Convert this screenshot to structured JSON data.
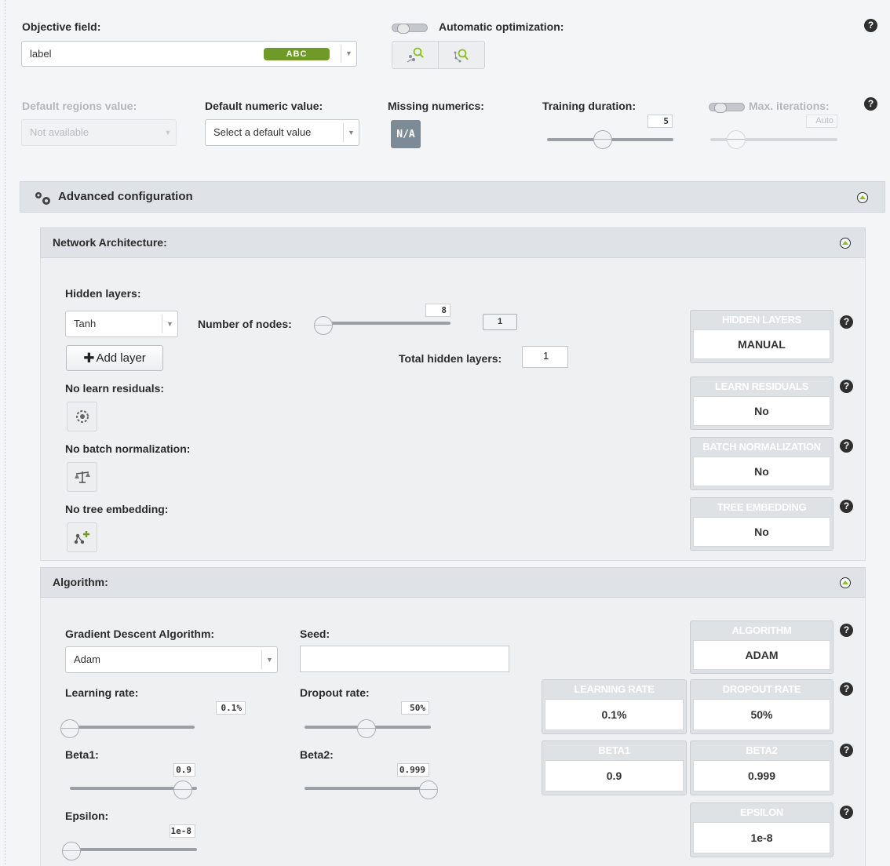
{
  "objective": {
    "label": "Objective field:",
    "value": "label",
    "type_badge": "ABC"
  },
  "auto_opt": {
    "label": "Automatic optimization:",
    "enabled": false
  },
  "top_row": {
    "default_regions": {
      "label": "Default regions value:",
      "value": "Not available"
    },
    "default_numeric": {
      "label": "Default numeric value:",
      "placeholder": "Select a default value"
    },
    "missing_numerics": {
      "label": "Missing numerics:",
      "button": "N/A"
    },
    "training_duration": {
      "label": "Training duration:",
      "value": "5",
      "level": 0.45
    },
    "max_iterations": {
      "label": "Max. iterations:",
      "value": "Auto"
    }
  },
  "advanced": {
    "title": "Advanced configuration"
  },
  "network": {
    "title": "Network Architecture:",
    "hidden_layers_label": "Hidden layers:",
    "activation": "Tanh",
    "nodes_label": "Number of nodes:",
    "nodes_value": "8",
    "layer_index": "1",
    "add_layer": "Add layer",
    "total_label": "Total hidden layers:",
    "total_value": "1",
    "learn_residuals_label": "No learn residuals:",
    "batch_norm_label": "No batch normalization:",
    "tree_embedding_label": "No tree embedding:",
    "summary": [
      {
        "header": "HIDDEN LAYERS",
        "value": "MANUAL"
      },
      {
        "header": "LEARN RESIDUALS",
        "value": "No"
      },
      {
        "header": "BATCH NORMALIZATION",
        "value": "No"
      },
      {
        "header": "TREE EMBEDDING",
        "value": "No"
      }
    ]
  },
  "algorithm": {
    "title": "Algorithm:",
    "gda_label": "Gradient Descent Algorithm:",
    "gda_value": "Adam",
    "seed_label": "Seed:",
    "seed_value": "",
    "learning_rate": {
      "label": "Learning rate:",
      "value": "0.1%",
      "level": 0.0
    },
    "dropout_rate": {
      "label": "Dropout rate:",
      "value": "50%",
      "level": 0.5
    },
    "beta1": {
      "label": "Beta1:",
      "value": "0.9",
      "level": 0.9
    },
    "beta2": {
      "label": "Beta2:",
      "value": "0.999",
      "level": 1.0
    },
    "epsilon": {
      "label": "Epsilon:",
      "value": "1e-8",
      "level": 0.0
    },
    "summary": {
      "algorithm": {
        "header": "ALGORITHM",
        "value": "ADAM"
      },
      "learning_rate": {
        "header": "LEARNING RATE",
        "value": "0.1%"
      },
      "dropout_rate": {
        "header": "DROPOUT RATE",
        "value": "50%"
      },
      "beta1": {
        "header": "BETA1",
        "value": "0.9"
      },
      "beta2": {
        "header": "BETA2",
        "value": "0.999"
      },
      "epsilon": {
        "header": "EPSILON",
        "value": "1e-8"
      }
    }
  },
  "help": "?"
}
